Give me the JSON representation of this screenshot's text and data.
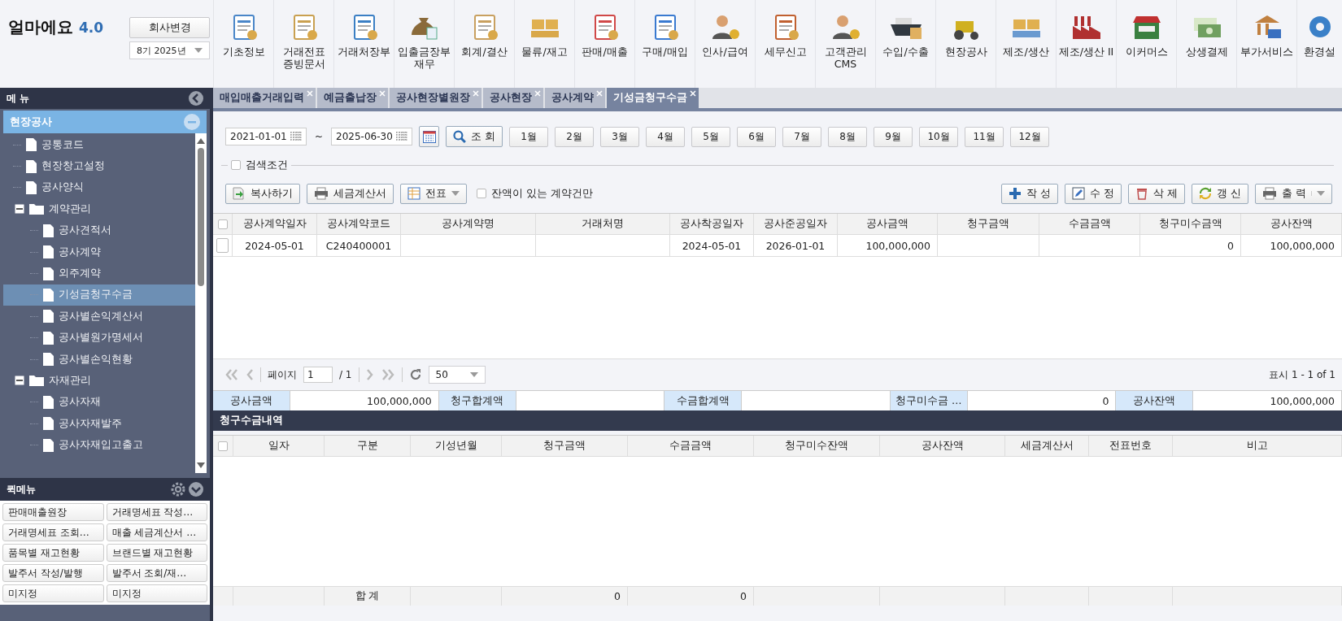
{
  "app": {
    "name": "얼마에요",
    "version": "4.0"
  },
  "company": {
    "button": "회사변경",
    "period": "8기 2025년"
  },
  "modules": [
    {
      "lines": [
        "기초정보"
      ]
    },
    {
      "lines": [
        "거래전표",
        "증빙문서"
      ]
    },
    {
      "lines": [
        "거래처장부"
      ]
    },
    {
      "lines": [
        "입출금장부",
        "재무"
      ]
    },
    {
      "lines": [
        "회계/결산"
      ]
    },
    {
      "lines": [
        "물류/재고"
      ]
    },
    {
      "lines": [
        "판매/매출"
      ]
    },
    {
      "lines": [
        "구매/매입"
      ]
    },
    {
      "lines": [
        "인사/급여"
      ]
    },
    {
      "lines": [
        "세무신고"
      ]
    },
    {
      "lines": [
        "고객관리",
        "CMS"
      ]
    },
    {
      "lines": [
        "수입/수출"
      ]
    },
    {
      "lines": [
        "현장공사"
      ]
    },
    {
      "lines": [
        "제조/생산"
      ]
    },
    {
      "lines": [
        "제조/생산 II"
      ]
    },
    {
      "lines": [
        "이커머스"
      ]
    },
    {
      "lines": [
        "상생결제"
      ]
    },
    {
      "lines": [
        "부가서비스"
      ]
    },
    {
      "lines": [
        "환경설"
      ]
    }
  ],
  "sidebar": {
    "title": "메 뉴",
    "section": {
      "label": "현장공사",
      "expanded": true
    },
    "tree": [
      {
        "label": "공통코드",
        "kind": "file",
        "selected": false
      },
      {
        "label": "현장창고설정",
        "kind": "file",
        "selected": false
      },
      {
        "label": "공사양식",
        "kind": "file",
        "selected": false
      },
      {
        "label": "계약관리",
        "kind": "folder",
        "expanded": true,
        "selected": false,
        "children": [
          {
            "label": "공사견적서",
            "kind": "file",
            "selected": false
          },
          {
            "label": "공사계약",
            "kind": "file",
            "selected": false
          },
          {
            "label": "외주계약",
            "kind": "file",
            "selected": false
          },
          {
            "label": "기성금청구수금",
            "kind": "file",
            "selected": true
          },
          {
            "label": "공사별손익계산서",
            "kind": "file",
            "selected": false
          },
          {
            "label": "공사별원가명세서",
            "kind": "file",
            "selected": false
          },
          {
            "label": "공사별손익현황",
            "kind": "file",
            "selected": false
          }
        ]
      },
      {
        "label": "자재관리",
        "kind": "folder",
        "expanded": true,
        "selected": false,
        "children": [
          {
            "label": "공사자재",
            "kind": "file",
            "selected": false
          },
          {
            "label": "공사자재발주",
            "kind": "file",
            "selected": false
          },
          {
            "label": "공사자재입고출고",
            "kind": "file",
            "selected": false
          }
        ]
      }
    ],
    "quick_menu": {
      "title": "퀵메뉴",
      "items": [
        "판매매출원장",
        "거래명세표 작성…",
        "거래명세표 조회…",
        "매출 세금계산서 …",
        "품목별 재고현황",
        "브랜드별 재고현황",
        "발주서 작성/발행",
        "발주서 조회/재…",
        "미지정",
        "미지정"
      ]
    }
  },
  "tabs": [
    {
      "label": "매입매출거래입력",
      "selected": false
    },
    {
      "label": "예금출납장",
      "selected": false
    },
    {
      "label": "공사현장별원장",
      "selected": false
    },
    {
      "label": "공사현장",
      "selected": false
    },
    {
      "label": "공사계약",
      "selected": false
    },
    {
      "label": "기성금청구수금",
      "selected": true
    }
  ],
  "filter": {
    "date_from": "2021-01-01",
    "separator": "~",
    "date_to": "2025-06-30",
    "search_button": "조 회",
    "months": [
      "1월",
      "2월",
      "3월",
      "4월",
      "5월",
      "6월",
      "7월",
      "8월",
      "9월",
      "10월",
      "11월",
      "12월"
    ],
    "search_conditions": {
      "label": "검색조건",
      "checked": false
    }
  },
  "toolbar": {
    "left": [
      {
        "label": "복사하기",
        "kind": "copy"
      },
      {
        "label": "세금계산서",
        "kind": "print"
      },
      {
        "label": "전표",
        "kind": "sheet-dropdown"
      }
    ],
    "balance_only": {
      "label": "잔액이 있는 계약건만",
      "checked": false
    },
    "right": [
      {
        "label": "작 성",
        "kind": "add"
      },
      {
        "label": "수 정",
        "kind": "edit"
      },
      {
        "label": "삭 제",
        "kind": "delete"
      },
      {
        "label": "갱 신",
        "kind": "refresh"
      },
      {
        "label": "출 력",
        "kind": "print-dropdown"
      }
    ]
  },
  "contracts": {
    "select_all": {
      "checked": false
    },
    "columns": [
      "공사계약일자",
      "공사계약코드",
      "공사계약명",
      "거래처명",
      "공사착공일자",
      "공사준공일자",
      "공사금액",
      "청구금액",
      "수금금액",
      "청구미수금액",
      "공사잔액"
    ],
    "rows": [
      {
        "checked": false,
        "contract_date": "2024-05-01",
        "contract_code": "C240400001",
        "start_date": "2024-05-01",
        "end_date": "2026-01-01",
        "amount": "100,000,000",
        "unpaid": "0",
        "balance": "100,000,000"
      }
    ]
  },
  "pager": {
    "label": "페이지",
    "page": "1",
    "total": "/ 1",
    "page_size": "50",
    "summary": "표시 1 - 1 of 1"
  },
  "summary": [
    {
      "label": "공사금액",
      "value": "100,000,000"
    },
    {
      "label": "청구합계액"
    },
    {
      "label": "수금합계액"
    },
    {
      "label": "청구미수금 …",
      "value": "0"
    },
    {
      "label": "공사잔액",
      "value": "100,000,000"
    }
  ],
  "history": {
    "title": "청구수금내역",
    "select_all": {
      "checked": false
    },
    "columns": [
      "일자",
      "구분",
      "기성년월",
      "청구금액",
      "수금금액",
      "청구미수잔액",
      "공사잔액",
      "세금계산서",
      "전표번호",
      "비고"
    ],
    "totals": {
      "label": "합 계",
      "billed": "0",
      "received": "0"
    }
  }
}
